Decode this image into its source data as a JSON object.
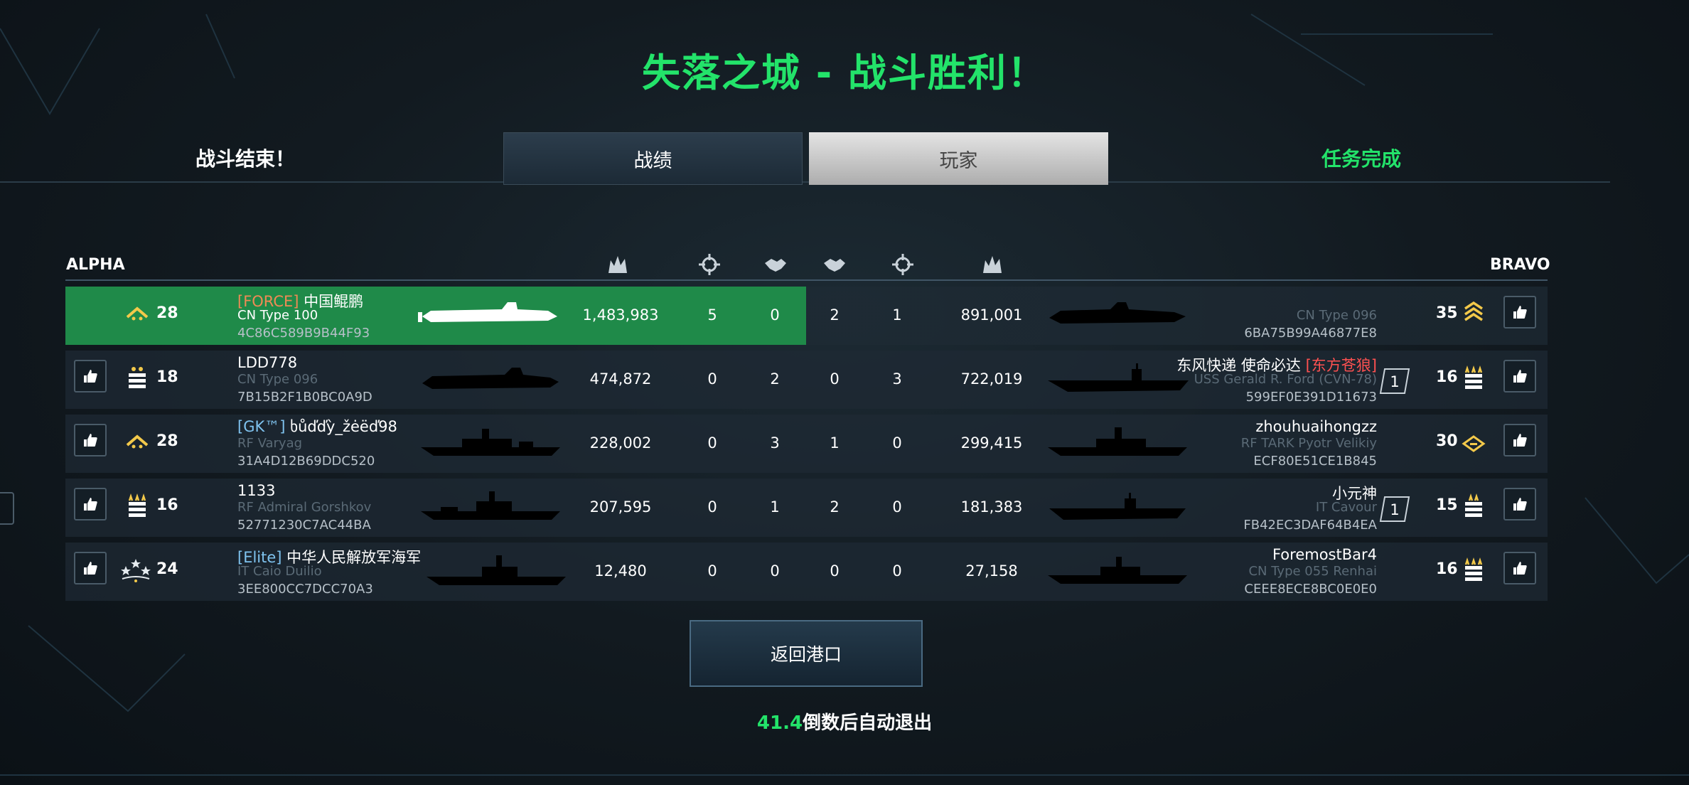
{
  "title": "失落之城 - 战斗胜利！",
  "header": {
    "battle_end": "战斗结束！",
    "tab_stats": "战绩",
    "tab_players": "玩家",
    "mission_done": "任务完成"
  },
  "teams": {
    "alpha": "ALPHA",
    "bravo": "BRAVO"
  },
  "column_icons": [
    "damage-icon",
    "target-icon",
    "assist-icon",
    "assist-icon",
    "target-icon",
    "damage-icon"
  ],
  "rows": [
    {
      "alpha": {
        "rank": "28",
        "clan": "[FORCE]",
        "name": " 中国鲲鹏",
        "ship": "CN Type 100",
        "id": "4C86C589B9B44F93",
        "damage": "1,483,983",
        "kills": "5",
        "assists": "0"
      },
      "bravo": {
        "rank": "35",
        "clan": "",
        "name": "",
        "ship": "CN Type 096",
        "id": "6BA75B99A46877E8",
        "damage": "891,001",
        "kills": "1",
        "assists": "2",
        "badge": ""
      }
    },
    {
      "alpha": {
        "rank": "18",
        "clan": "",
        "name": "LDD778",
        "ship": "CN Type 096",
        "id": "7B15B2F1B0BC0A9D",
        "damage": "474,872",
        "kills": "0",
        "assists": "2"
      },
      "bravo": {
        "rank": "16",
        "clan": "[东方苍狼]",
        "name": "东风快递 使命必达 ",
        "ship": "USS Gerald R. Ford (CVN-78)",
        "id": "599EF0E391D11673",
        "damage": "722,019",
        "kills": "3",
        "assists": "0",
        "badge": "1"
      }
    },
    {
      "alpha": {
        "rank": "28",
        "clan": "[GK™]",
        "name": " ხůďďỳ_žėëď98",
        "ship": "RF Varyag",
        "id": "31A4D12B69DDC520",
        "damage": "228,002",
        "kills": "0",
        "assists": "3"
      },
      "bravo": {
        "rank": "30",
        "clan": "",
        "name": "zhouhuaihongzz",
        "ship": "RF TARK Pyotr Velikiy",
        "id": "ECF80E51CE1B845",
        "damage": "299,415",
        "kills": "0",
        "assists": "1",
        "badge": ""
      }
    },
    {
      "alpha": {
        "rank": "16",
        "clan": "",
        "name": "1133",
        "ship": "RF Admiral Gorshkov",
        "id": "52771230C7AC44BA",
        "damage": "207,595",
        "kills": "0",
        "assists": "1"
      },
      "bravo": {
        "rank": "15",
        "clan": "",
        "name": "小元神",
        "ship": "IT Cavour",
        "id": "FB42EC3DAF64B4EA",
        "damage": "181,383",
        "kills": "0",
        "assists": "2",
        "badge": "1"
      }
    },
    {
      "alpha": {
        "rank": "24",
        "clan": "[Elite]",
        "name": " 中华人民解放军海军",
        "ship": "IT Caio Duilio",
        "id": "3EE800CC7DCC70A3",
        "damage": "12,480",
        "kills": "0",
        "assists": "0"
      },
      "bravo": {
        "rank": "16",
        "clan": "",
        "name": "ForemostBar4",
        "ship": "CN Type 055 Renhai",
        "id": "CEEE8ECE8BC0E0E0",
        "damage": "27,158",
        "kills": "0",
        "assists": "0",
        "badge": ""
      }
    }
  ],
  "return_button": "返回港口",
  "countdown": {
    "seconds": "41.4",
    "text": "倒数后自动退出"
  },
  "colors": {
    "accent_green": "#23e36a",
    "highlight_row": "#1f8a49",
    "clan_red": "#ff5151",
    "clan_blue": "#7fc3ef",
    "clan_orange": "#ef8a55"
  }
}
